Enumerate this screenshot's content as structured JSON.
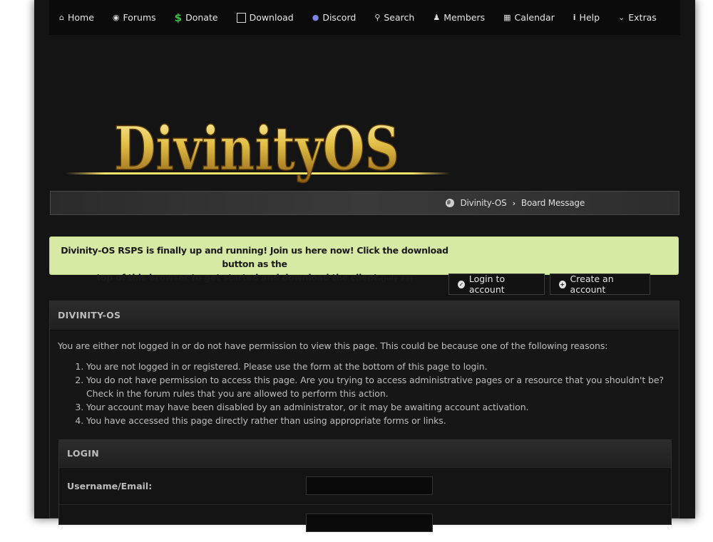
{
  "nav": {
    "items": [
      {
        "label": "Home",
        "icon": "home-icon"
      },
      {
        "label": "Forums",
        "icon": "comments-icon"
      },
      {
        "label": "Donate",
        "icon": "dollar-icon"
      },
      {
        "label": "Download",
        "icon": "download-icon"
      },
      {
        "label": "Discord",
        "icon": "discord-icon"
      },
      {
        "label": "Search",
        "icon": "search-icon"
      },
      {
        "label": "Members",
        "icon": "users-icon"
      },
      {
        "label": "Calendar",
        "icon": "calendar-icon"
      },
      {
        "label": "Help",
        "icon": "info-icon"
      },
      {
        "label": "Extras",
        "icon": "chevron-down-icon"
      }
    ]
  },
  "logo": {
    "text": "DivinityOS"
  },
  "breadcrumb": {
    "root": "Divinity-OS",
    "current": "Board Message"
  },
  "announcement": {
    "line1": "Divinity-OS RSPS is finally up and running! Join us here now! Click the download button as the",
    "line2": "top of this browser to get started and download the client.",
    "date": "(July 23)"
  },
  "account": {
    "login_label": "Login to account",
    "create_label": "Create an account"
  },
  "panel": {
    "title": "DIVINITY-OS",
    "intro": "You are either not logged in or do not have permission to view this page. This could be because one of the following reasons:",
    "reasons": [
      "You are not logged in or registered. Please use the form at the bottom of this page to login.",
      "You do not have permission to access this page. Are you trying to access administrative pages or a resource that you shouldn't be? Check in the forum rules that you are allowed to perform this action.",
      "Your account may have been disabled by an administrator, or it may be awaiting account activation.",
      "You have accessed this page directly rather than using appropriate forms or links."
    ]
  },
  "login": {
    "title": "LOGIN",
    "username_label": "Username/Email:",
    "username_value": "",
    "password_value": ""
  },
  "colors": {
    "accent_gold": "#d9b94a",
    "announce_bg": "#d6eaa6",
    "page_bg": "#141414"
  }
}
